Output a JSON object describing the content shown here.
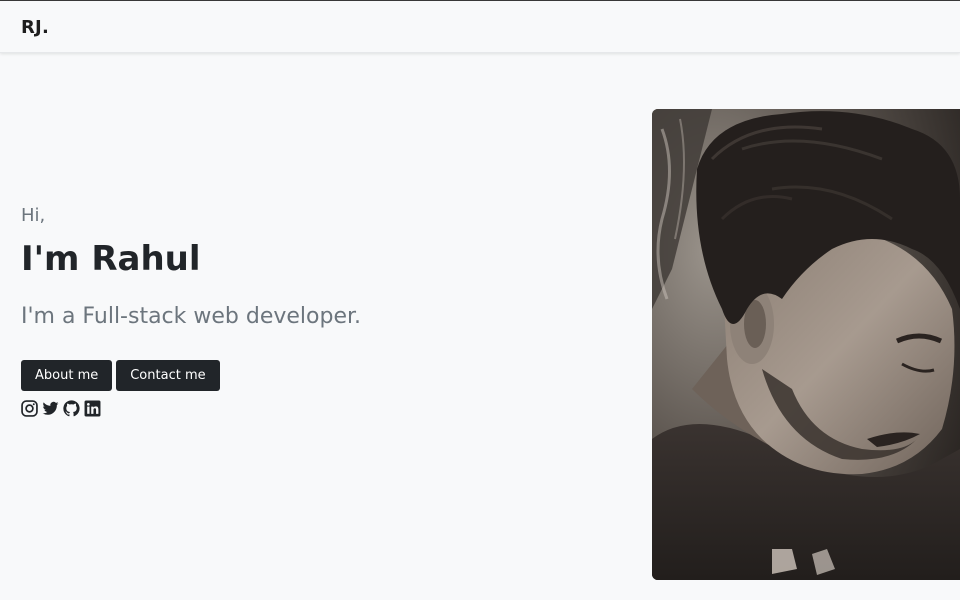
{
  "navbar": {
    "brand": "RJ."
  },
  "hero": {
    "greeting": "Hi,",
    "name": "I'm Rahul",
    "tagline": "I'm a Full-stack web developer.",
    "buttons": [
      {
        "label": "About me"
      },
      {
        "label": "Contact me"
      }
    ],
    "socials": [
      "instagram-icon",
      "twitter-icon",
      "github-icon",
      "linkedin-icon"
    ]
  },
  "colors": {
    "background": "#f8f9fa",
    "text_dark": "#212529",
    "text_muted": "#6c757d",
    "button_bg": "#212529",
    "button_text": "#ffffff"
  }
}
